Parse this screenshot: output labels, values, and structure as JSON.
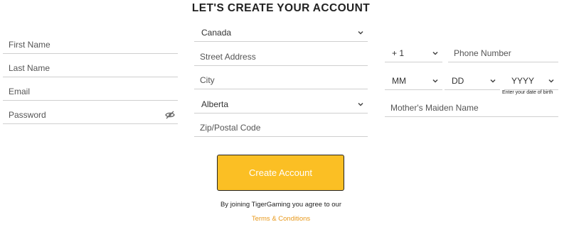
{
  "title": "LET'S CREATE YOUR ACCOUNT",
  "left": {
    "first_name": "First Name",
    "last_name": "Last Name",
    "email": "Email",
    "password": "Password"
  },
  "middle": {
    "country": "Canada",
    "street": "Street Address",
    "city": "City",
    "province": "Alberta",
    "postal": "Zip/Postal Code"
  },
  "right": {
    "phone_code": "+ 1",
    "phone": "Phone Number",
    "month": "MM",
    "day": "DD",
    "year": "YYYY",
    "dob_hint": "Enter your date of birth",
    "maiden_name": "Mother's Maiden Name"
  },
  "button": {
    "label": "Create Account"
  },
  "footer": {
    "agree": "By joining TigerGaming you agree to our",
    "terms": "Terms & Conditions"
  },
  "colors": {
    "accent": "#fbbf24",
    "link": "#e8981a"
  },
  "icons": {
    "eye": "eye-slash-icon",
    "chevron": "chevron-down-icon"
  }
}
